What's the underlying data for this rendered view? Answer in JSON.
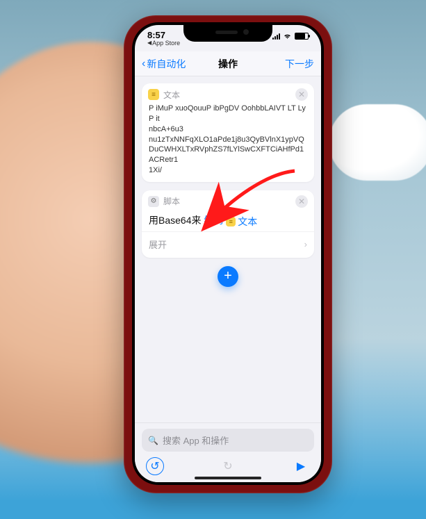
{
  "status": {
    "time": "8:57",
    "back_app_prefix": "◀",
    "back_app": "App Store"
  },
  "nav": {
    "back": "新自动化",
    "title": "操作",
    "next": "下一步"
  },
  "cards": {
    "text": {
      "label": "文本",
      "body_line1": "P iMuP xuoQouuP ibPgDV OohbbLAIVT LT Ly P it",
      "body_line2": "nbcA+6u3",
      "body_line3": "nu1zTxNNFqXLO1aPde1j8u3QyBVlnX1ypVQ",
      "body_line4": "DuCWHXLTxRVphZS7fLYlSwCXFTCiAHfPd1",
      "body_line5": "ACRetr1",
      "body_line6": "1Xi/"
    },
    "script": {
      "label": "脚本",
      "prefix": "用Base64来",
      "action": "编码",
      "chip": "文本",
      "expand": "展开"
    }
  },
  "search": {
    "placeholder": "搜索 App 和操作"
  },
  "icons": {
    "text": "≡",
    "script": "⚙",
    "close": "✕",
    "chevron_left": "‹",
    "chevron_right": "›",
    "plus": "+",
    "search": "🔍",
    "undo": "↺",
    "redo": "↻",
    "play": "▶"
  }
}
